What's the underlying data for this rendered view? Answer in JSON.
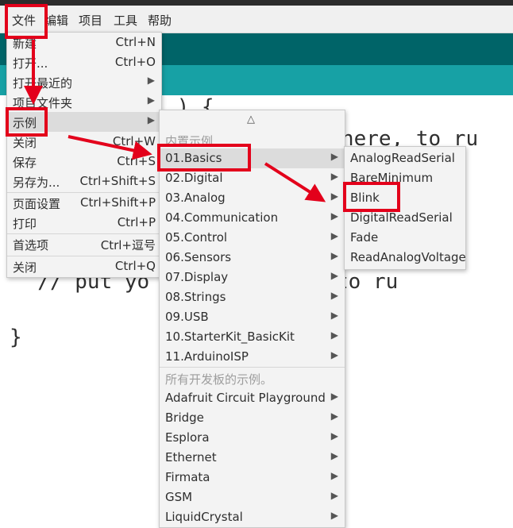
{
  "menubar": {
    "items": [
      "文件",
      "编辑",
      "项目",
      "工具",
      "帮助"
    ]
  },
  "editor": {
    "code_lines": [
      "    ) {",
      "    e here, to ru",
      "  // put yo         here, to ru",
      "}"
    ]
  },
  "file_menu": {
    "items": [
      {
        "label": "新建",
        "shortcut": "Ctrl+N"
      },
      {
        "label": "打开...",
        "shortcut": "Ctrl+O"
      },
      {
        "label": "打开最近的"
      },
      {
        "label": "项目文件夹"
      },
      {
        "label": "示例"
      },
      {
        "label": "关闭",
        "shortcut": "Ctrl+W"
      },
      {
        "label": "保存",
        "shortcut": "Ctrl+S"
      },
      {
        "label": "另存为...",
        "shortcut": "Ctrl+Shift+S"
      },
      {
        "label": "页面设置",
        "shortcut": "Ctrl+Shift+P"
      },
      {
        "label": "打印",
        "shortcut": "Ctrl+P"
      },
      {
        "label": "首选项",
        "shortcut": "Ctrl+逗号"
      },
      {
        "label": "关闭",
        "shortcut": "Ctrl+Q"
      }
    ]
  },
  "examples_menu": {
    "scroll_up": "△",
    "builtin_header": "内置示例",
    "builtin": [
      "01.Basics",
      "02.Digital",
      "03.Analog",
      "04.Communication",
      "05.Control",
      "06.Sensors",
      "07.Display",
      "08.Strings",
      "09.USB",
      "10.StarterKit_BasicKit",
      "11.ArduinoISP"
    ],
    "all_boards_header": "所有开发板的示例。",
    "libraries": [
      "Adafruit Circuit Playground",
      "Bridge",
      "Esplora",
      "Ethernet",
      "Firmata",
      "GSM",
      "LiquidCrystal"
    ]
  },
  "basics_menu": {
    "items": [
      "AnalogReadSerial",
      "BareMinimum",
      "Blink",
      "DigitalReadSerial",
      "Fade",
      "ReadAnalogVoltage"
    ]
  },
  "colors": {
    "annotation": "#e3001b",
    "teal_dark": "#006468",
    "teal_light": "#17a1a5"
  }
}
